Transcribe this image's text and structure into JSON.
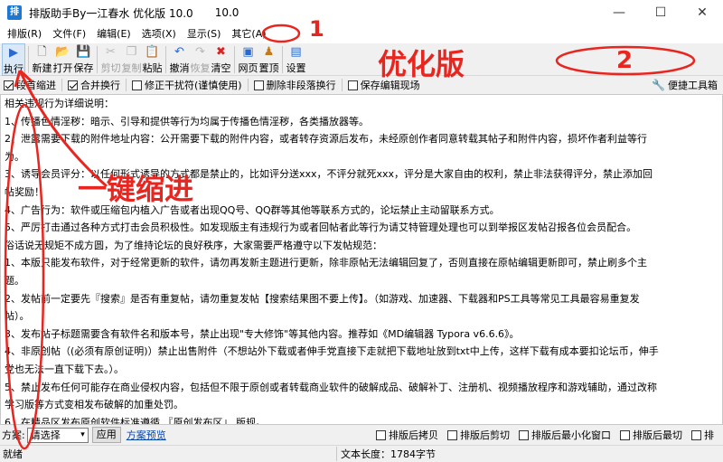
{
  "window": {
    "title": "排版助手By一江春水 优化版 10.0",
    "version": "10.0",
    "min_glyph": "—",
    "max_glyph": "☐",
    "close_glyph": "✕",
    "app_icon_glyph": "排"
  },
  "menu": [
    "排版(R)",
    "文件(F)",
    "编辑(E)",
    "选项(X)",
    "显示(S)",
    "其它(A)"
  ],
  "toolbar": [
    {
      "label": "执行",
      "icon": "play-icon",
      "glyph": "▶",
      "color": "#2a6ad0",
      "disabled": false
    },
    {
      "label": "新建",
      "icon": "new-file-icon",
      "glyph": "🗋",
      "color": "#555555",
      "disabled": false
    },
    {
      "label": "打开",
      "icon": "open-folder-icon",
      "glyph": "📂",
      "color": "#d9a520",
      "disabled": false
    },
    {
      "label": "保存",
      "icon": "save-icon",
      "glyph": "💾",
      "color": "#3a5fb0",
      "disabled": false
    },
    {
      "label": "剪切",
      "icon": "cut-icon",
      "glyph": "✂",
      "color": "#b8b8b8",
      "disabled": true
    },
    {
      "label": "复制",
      "icon": "copy-icon",
      "glyph": "❐",
      "color": "#b8b8b8",
      "disabled": true
    },
    {
      "label": "粘贴",
      "icon": "paste-icon",
      "glyph": "📋",
      "color": "#a06a2a",
      "disabled": false
    },
    {
      "label": "撤消",
      "icon": "undo-icon",
      "glyph": "↶",
      "color": "#2a6ad0",
      "disabled": false
    },
    {
      "label": "恢复",
      "icon": "redo-icon",
      "glyph": "↷",
      "color": "#b8b8b8",
      "disabled": true
    },
    {
      "label": "清空",
      "icon": "clear-icon",
      "glyph": "✖",
      "color": "#e02020",
      "disabled": false
    },
    {
      "label": "网页",
      "icon": "web-icon",
      "glyph": "▣",
      "color": "#2a6ad0",
      "disabled": false
    },
    {
      "label": "置顶",
      "icon": "pin-top-icon",
      "glyph": "♟",
      "color": "#c07a20",
      "disabled": false
    },
    {
      "label": "设置",
      "icon": "settings-icon",
      "glyph": "▤",
      "color": "#2a6ad0",
      "disabled": false
    }
  ],
  "options": [
    {
      "label": "段首缩进",
      "checked": true
    },
    {
      "label": "合并换行",
      "checked": true
    },
    {
      "label": "修正干扰符(谨慎使用)",
      "checked": false
    },
    {
      "label": "删除非段落换行",
      "checked": false
    },
    {
      "label": "保存编辑现场",
      "checked": false
    }
  ],
  "toolbox": {
    "label": "便捷工具箱",
    "glyph": "🔧"
  },
  "editor_lines": [
    "    相关违规行为详细说明：",
    "    1、传播色情淫秽：暗示、引导和提供等行为均属于传播色情淫秽，各类播放器等。",
    "    2、泄露需要下载的附件地址内容：公开需要下载的附件内容，或者转存资源后发布，未经原创作者同意转载其帖子和附件内容，损坏作者利益等行",
    "为。",
    "    3、诱导会员评分：以任何形式诱导的方式都是禁止的，比如评分送xxx，不评分就死xxx，评分是大家自由的权利，禁止非法获得评分，禁止添加回",
    "帖奖励！",
    "    4、广告行为：软件或压缩包内植入广告或者出现QQ号、QQ群等其他等联系方式的，论坛禁止主动留联系方式。",
    "    5、严厉打击通过各种方式打击会员积极性。如发现版主有违规行为或者回帖者此等行为请艾特管理处理也可以到举报区发帖감报各位会员配合。",
    "    俗话说无规矩不成方圆，为了维持论坛的良好秩序，大家需要严格遵守以下发帖规范：",
    "    1、本版只能发布软件，对于经常更新的软件，请勿再发新主题进行更新，除非原帖无法编辑回复了，否则直接在原帖编辑更新即可，禁止刷多个主",
    "题。",
    "    2、发帖前一定要先『搜索』是否有重复帖，请勿重复发帖【搜索结果图不要上传】。（如游戏、加速器、下载器和PS工具等常见工具最容易重复发",
    "帖）。",
    "    3、发布帖子标题需要含有软件名和版本号，禁止出现\"专大修饰\"等其他内容。推荐如《MD编辑器 Typora v6.6.6》。",
    "    4、非原创帖（(必须有原创证明)）禁止出售附件（不想站外下载或者伸手党直接下走就把下载地址放到txt中上传，这样下载有成本要扣论坛币，伸手",
    "党也无法一直下载下去。）。",
    "    5、禁止发布任何可能存在商业侵权内容，包括但不限于原创或者转载商业软件的破解成品、破解补丁、注册机、视频播放程序和游戏辅助，通过改称",
    "学习版等方式变相发布破解的加重处罚。",
    "    6、在精品区发布原创软件标准遵循 『原创发布区』 版规。"
  ],
  "scheme": {
    "label": "方案:",
    "selected": "请选择",
    "arrow": "▾",
    "apply": "应用",
    "preview": "方案预览"
  },
  "after_options": [
    {
      "label": "排版后拷贝",
      "checked": false
    },
    {
      "label": "排版后剪切",
      "checked": false
    },
    {
      "label": "排版后最小化窗口",
      "checked": false
    },
    {
      "label": "排版后最切",
      "checked": false
    },
    {
      "label": "排",
      "checked": false
    }
  ],
  "status": {
    "ready": "就绪",
    "length": "文本长度：1784字节"
  },
  "annotations": {
    "number_1": "1",
    "number_2": "2",
    "optimized_label": "优化版",
    "one_click_indent": "一键缩进",
    "color": "#e8261f"
  }
}
